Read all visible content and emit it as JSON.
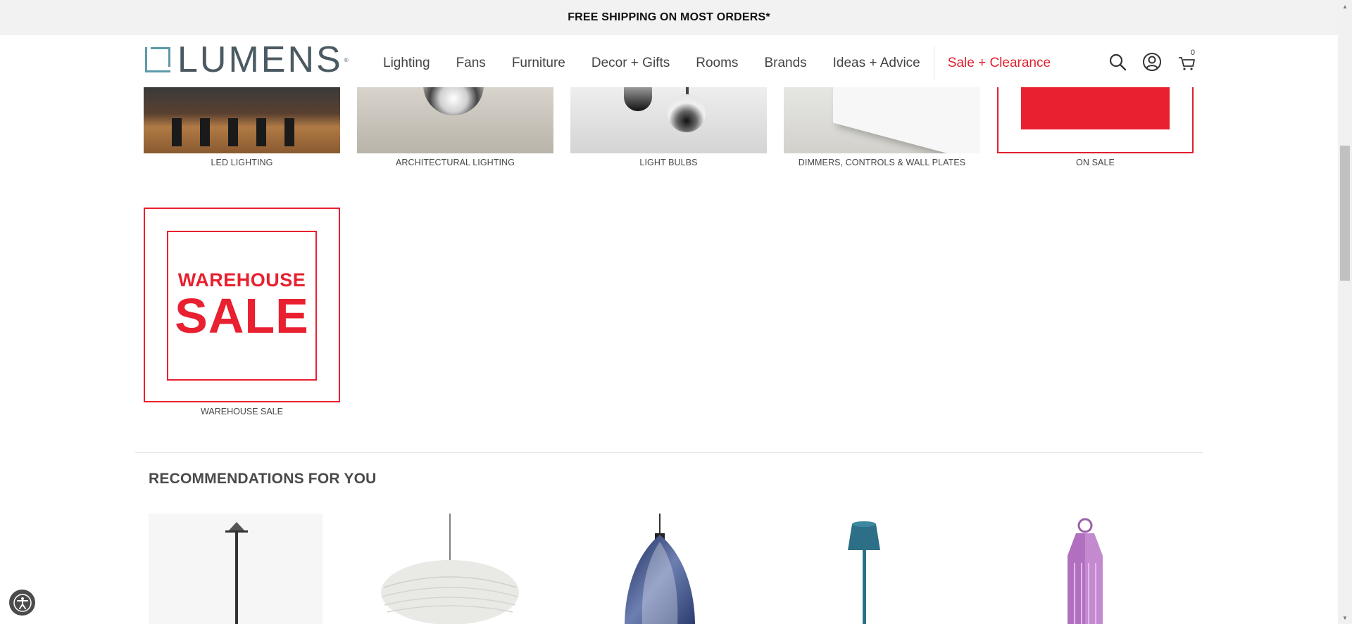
{
  "promo": {
    "text": "FREE SHIPPING ON MOST ORDERS*"
  },
  "header": {
    "logo": {
      "text": "LUMENS",
      "tm": "®"
    },
    "nav": [
      {
        "label": "Lighting"
      },
      {
        "label": "Fans"
      },
      {
        "label": "Furniture"
      },
      {
        "label": "Decor + Gifts"
      },
      {
        "label": "Rooms"
      },
      {
        "label": "Brands"
      },
      {
        "label": "Ideas + Advice"
      }
    ],
    "sale_label": "Sale + Clearance",
    "icons": {
      "search": "search-icon",
      "account": "account-icon",
      "cart": "cart-icon"
    },
    "cart_count": "0"
  },
  "categories": [
    {
      "label": "LED LIGHTING"
    },
    {
      "label": "ARCHITECTURAL LIGHTING"
    },
    {
      "label": "LIGHT BULBS"
    },
    {
      "label": "DIMMERS, CONTROLS & WALL PLATES"
    },
    {
      "label": "ON SALE"
    }
  ],
  "warehouse": {
    "line1": "WAREHOUSE",
    "line2": "SALE",
    "label": "WAREHOUSE SALE"
  },
  "recommendations": {
    "title": "RECOMMENDATIONS FOR YOU"
  },
  "colors": {
    "accent_red": "#e01f2e",
    "logo_teal": "#5d9aa8",
    "logo_gray": "#4b5a62"
  },
  "accessibility": {
    "icon": "accessibility-icon"
  }
}
